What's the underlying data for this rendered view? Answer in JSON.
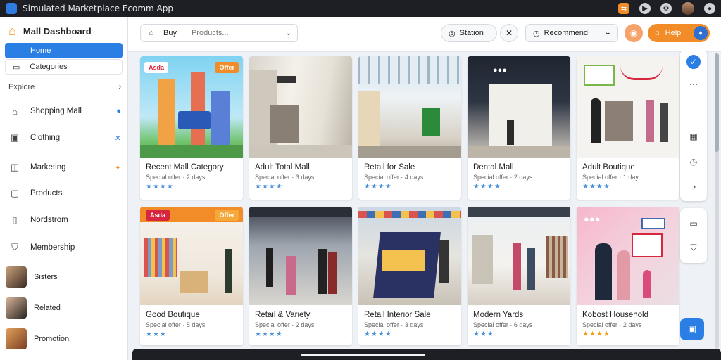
{
  "window": {
    "title": "Simulated Marketplace Ecomm App"
  },
  "sidebar": {
    "brand": "Mall Dashboard",
    "active": "Home",
    "sub": "Categories",
    "section_label": "Explore",
    "items": [
      {
        "label": "Shopping Mall",
        "icon": "store-icon"
      },
      {
        "label": "Clothing",
        "icon": "shirt-icon"
      },
      {
        "label": "Marketing",
        "icon": "megaphone-icon"
      },
      {
        "label": "Products",
        "icon": "box-icon"
      },
      {
        "label": "Nordstrom",
        "icon": "tag-icon"
      },
      {
        "label": "Membership",
        "icon": "shield-icon"
      }
    ],
    "people": [
      {
        "label": "Sisters"
      },
      {
        "label": "Related"
      },
      {
        "label": "Promotion"
      }
    ]
  },
  "toolbar": {
    "search_label": "Buy",
    "search_placeholder": "Products...",
    "pill1": "Station",
    "pill2": "Recommend",
    "orange_btn": "Help"
  },
  "cards": [
    {
      "title": "Recent Mall Category",
      "subtitle": "Special offer · 2 days",
      "tag": "Offer",
      "stars": "★★★★"
    },
    {
      "title": "Adult Total Mall",
      "subtitle": "Special offer · 3 days",
      "tag": "",
      "stars": "★★★★"
    },
    {
      "title": "Retail for Sale",
      "subtitle": "Special offer · 4 days",
      "tag": "",
      "stars": "★★★★"
    },
    {
      "title": "Dental Mall",
      "subtitle": "Special offer · 2 days",
      "tag": "",
      "stars": "★★★★"
    },
    {
      "title": "Adult Boutique",
      "subtitle": "Special offer · 1 day",
      "tag": "",
      "stars": "★★★★"
    },
    {
      "title": "Good Boutique",
      "subtitle": "Special offer · 5 days",
      "tag": "Offer",
      "stars": "★★★"
    },
    {
      "title": "Retail & Variety",
      "subtitle": "Special offer · 2 days",
      "tag": "",
      "stars": "★★★★"
    },
    {
      "title": "Retail Interior Sale",
      "subtitle": "Special offer · 3 days",
      "tag": "",
      "stars": "★★★★"
    },
    {
      "title": "Modern Yards",
      "subtitle": "Special offer · 6 days",
      "tag": "",
      "stars": "★★★"
    },
    {
      "title": "Kobost Household",
      "subtitle": "Special offer · 2 days",
      "tag": "",
      "stars": "★★★★"
    }
  ],
  "colors": {
    "accent": "#2a7ee4",
    "orange": "#f28c28"
  }
}
